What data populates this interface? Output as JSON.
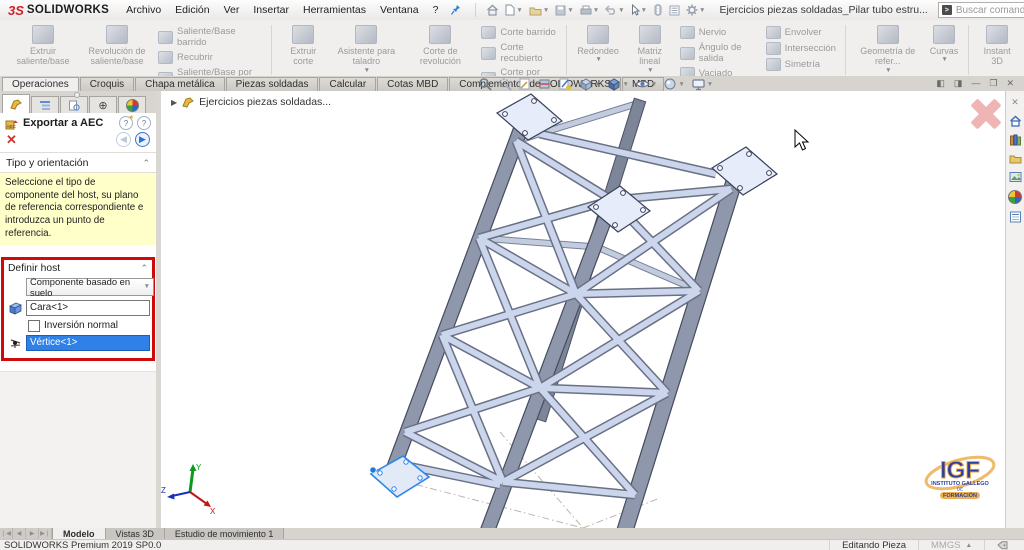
{
  "colors": {
    "annotation_red": "#cf0a0a",
    "selection_blue": "#2f80e7",
    "brand_red": "#d21e2b",
    "message_yellow": "#ffffc9",
    "steel_dark": "#8e97ab",
    "steel_light": "#cbd5ec"
  },
  "titlebar": {
    "logo_mark": "3S",
    "logo_text": "SOLIDWORKS",
    "menus": [
      "Archivo",
      "Edición",
      "Ver",
      "Insertar",
      "Herramientas",
      "Ventana",
      "?"
    ],
    "document_title": "Ejercicios piezas soldadas_Pilar tubo estru...",
    "search_placeholder": "Buscar comandos"
  },
  "ribbon": {
    "g1_big": [
      "Extruir saliente/base",
      "Revolución de saliente/base"
    ],
    "g1_small": [
      "Saliente/Base barrido",
      "Recubrir",
      "Saliente/Base por límite"
    ],
    "g2_big": [
      "Extruir corte",
      "Asistente para taladro",
      "Corte de revolución"
    ],
    "g2_small": [
      "Corte barrido",
      "Corte recubierto",
      "Corte por límite"
    ],
    "g3_big": [
      "Redondeo",
      "Matriz lineal"
    ],
    "g3_small_a": [
      "Nervio",
      "Ángulo de salida",
      "Vaciado"
    ],
    "g3_small_b": [
      "Envolver",
      "Intersección",
      "Simetría"
    ],
    "g4_big": [
      "Geometría de refer...",
      "Curvas"
    ],
    "g5_big": [
      "Instant 3D"
    ]
  },
  "command_tabs": [
    "Operaciones",
    "Croquis",
    "Chapa metálica",
    "Piezas soldadas",
    "Calcular",
    "Cotas MBD",
    "Complementos de SOLIDWORKS",
    "MBD"
  ],
  "property_manager": {
    "title": "Exportar a AEC",
    "section_header": "Tipo y orientación",
    "message": "Seleccione el tipo de componente del host, su plano de referencia correspondiente e introduzca un punto de referencia.",
    "group_label": "Definir host",
    "host_type_value": "Componente basado en suelo",
    "face_value": "Cara<1>",
    "invert_checkbox_label": "Inversión normal",
    "vertex_value": "Vértice<1>"
  },
  "viewport": {
    "tree_item_label": "Ejercicios piezas soldadas...",
    "triad_labels": {
      "x": "X",
      "y": "Y",
      "z": "Z"
    },
    "watermark": {
      "acronym": "IGF",
      "line1": "INSTITUTO GALLEGO",
      "line2": "DE",
      "line3": "FORMACIÓN"
    }
  },
  "doc_tabs": [
    "Modelo",
    "Vistas 3D",
    "Estudio de movimiento 1"
  ],
  "status_bar": {
    "app_version": "SOLIDWORKS Premium 2019 SP0.0",
    "edit_mode": "Editando Pieza",
    "unit_system": "MMGS"
  }
}
